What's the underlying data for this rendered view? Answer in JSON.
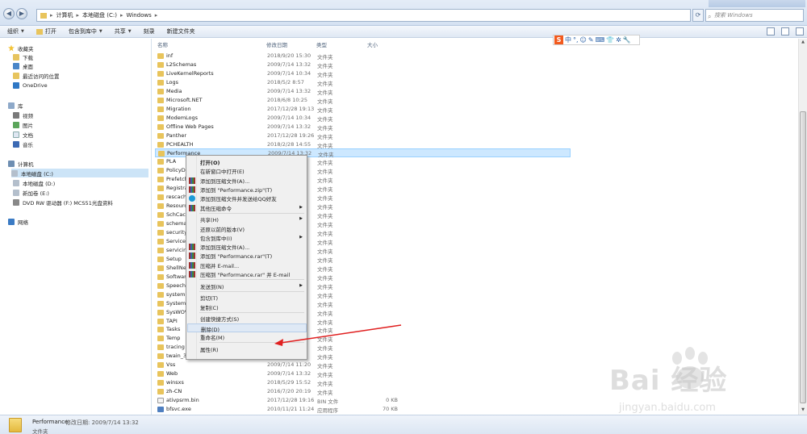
{
  "addressbar": {
    "crumbs": [
      "计算机",
      "本地磁盘 (C:)",
      "Windows"
    ],
    "search_placeholder": "搜索 Windows"
  },
  "toolbar": {
    "organize": "组织",
    "open": "打开",
    "include_library": "包含到库中",
    "share": "共享",
    "burn": "刻录",
    "new_folder": "新建文件夹"
  },
  "ime": {
    "logo": "S",
    "glyphs": [
      "中",
      "°,",
      "☺",
      "✎",
      "⌨",
      "👕",
      "✲",
      "🔧"
    ]
  },
  "navpane": {
    "favorites": "收藏夹",
    "downloads": "下载",
    "desktop": "桌面",
    "recent": "最近访问的位置",
    "onedrive": "OneDrive",
    "libraries": "库",
    "videos": "视频",
    "pictures": "图片",
    "documents": "文档",
    "music": "音乐",
    "computer": "计算机",
    "drive_c": "本地磁盘 (C:)",
    "drive_d": "本地磁盘 (D:)",
    "drive_e": "新加卷 (E:)",
    "drive_f": "DVD RW 驱动器 (F:) MCS51光盘资料",
    "network": "网络"
  },
  "columns": {
    "name": "名称",
    "date": "修改日期",
    "type": "类型",
    "size": "大小"
  },
  "files": [
    {
      "name": "inf",
      "date": "2018/9/20 15:30",
      "type": "文件夹",
      "size": ""
    },
    {
      "name": "L2Schemas",
      "date": "2009/7/14 13:32",
      "type": "文件夹",
      "size": ""
    },
    {
      "name": "LiveKernelReports",
      "date": "2009/7/14 10:34",
      "type": "文件夹",
      "size": ""
    },
    {
      "name": "Logs",
      "date": "2018/5/2 8:57",
      "type": "文件夹",
      "size": ""
    },
    {
      "name": "Media",
      "date": "2009/7/14 13:32",
      "type": "文件夹",
      "size": ""
    },
    {
      "name": "Microsoft.NET",
      "date": "2018/6/8 10:25",
      "type": "文件夹",
      "size": ""
    },
    {
      "name": "Migration",
      "date": "2017/12/28 19:13",
      "type": "文件夹",
      "size": ""
    },
    {
      "name": "ModemLogs",
      "date": "2009/7/14 10:34",
      "type": "文件夹",
      "size": ""
    },
    {
      "name": "Offline Web Pages",
      "date": "2009/7/14 13:32",
      "type": "文件夹",
      "size": ""
    },
    {
      "name": "Panther",
      "date": "2017/12/28 19:26",
      "type": "文件夹",
      "size": ""
    },
    {
      "name": "PCHEALTH",
      "date": "2018/2/28 14:55",
      "type": "文件夹",
      "size": ""
    },
    {
      "name": "Performance",
      "date": "2009/7/14 13:32",
      "type": "文件夹",
      "size": ""
    },
    {
      "name": "PLA",
      "date": "",
      "type": "文件夹",
      "size": ""
    },
    {
      "name": "PolicyDe",
      "date": "",
      "type": "文件夹",
      "size": ""
    },
    {
      "name": "Prefetch",
      "date": "",
      "type": "文件夹",
      "size": ""
    },
    {
      "name": "Registra",
      "date": "",
      "type": "文件夹",
      "size": ""
    },
    {
      "name": "rescach",
      "date": "",
      "type": "文件夹",
      "size": ""
    },
    {
      "name": "Resourc",
      "date": "",
      "type": "文件夹",
      "size": ""
    },
    {
      "name": "SchCach",
      "date": "",
      "type": "文件夹",
      "size": ""
    },
    {
      "name": "schemas",
      "date": "",
      "type": "文件夹",
      "size": ""
    },
    {
      "name": "security",
      "date": "",
      "type": "文件夹",
      "size": ""
    },
    {
      "name": "ServiceP",
      "date": "",
      "type": "文件夹",
      "size": ""
    },
    {
      "name": "servicing",
      "date": "",
      "type": "文件夹",
      "size": ""
    },
    {
      "name": "Setup",
      "date": "",
      "type": "文件夹",
      "size": ""
    },
    {
      "name": "ShellNe",
      "date": "",
      "type": "文件夹",
      "size": ""
    },
    {
      "name": "Softwar",
      "date": "",
      "type": "文件夹",
      "size": ""
    },
    {
      "name": "Speech",
      "date": "",
      "type": "文件夹",
      "size": ""
    },
    {
      "name": "system",
      "date": "",
      "type": "文件夹",
      "size": ""
    },
    {
      "name": "System3",
      "date": "",
      "type": "文件夹",
      "size": ""
    },
    {
      "name": "SysWOV",
      "date": "",
      "type": "文件夹",
      "size": ""
    },
    {
      "name": "TAPI",
      "date": "",
      "type": "文件夹",
      "size": ""
    },
    {
      "name": "Tasks",
      "date": "",
      "type": "文件夹",
      "size": ""
    },
    {
      "name": "Temp",
      "date": "",
      "type": "文件夹",
      "size": ""
    },
    {
      "name": "tracing",
      "date": "",
      "type": "文件夹",
      "size": ""
    },
    {
      "name": "twain_32",
      "date": "",
      "type": "文件夹",
      "size": ""
    },
    {
      "name": "Vss",
      "date": "2009/7/14 11:20",
      "type": "文件夹",
      "size": ""
    },
    {
      "name": "Web",
      "date": "2009/7/14 13:32",
      "type": "文件夹",
      "size": ""
    },
    {
      "name": "winsxs",
      "date": "2018/5/29 15:52",
      "type": "文件夹",
      "size": ""
    },
    {
      "name": "zh-CN",
      "date": "2016/7/20 20:19",
      "type": "文件夹",
      "size": ""
    },
    {
      "name": "ativpsrm.bin",
      "date": "2017/12/28 19:16",
      "type": "BIN 文件",
      "size": "0 KB"
    },
    {
      "name": "bfsvc.exe",
      "date": "2010/11/21 11:24",
      "type": "应用程序",
      "size": "70 KB"
    }
  ],
  "menu": [
    {
      "label": "打开(O)",
      "bold": true,
      "arrow": false,
      "icon": ""
    },
    {
      "label": "在新窗口中打开(E)",
      "arrow": false,
      "icon": ""
    },
    {
      "label": "添加到压缩文件(A)...",
      "arrow": false,
      "icon": "rar"
    },
    {
      "label": "添加到 \"Performance.zip\"(T)",
      "arrow": false,
      "icon": "rar"
    },
    {
      "label": "添加到压缩文件并发送给QQ好友",
      "arrow": false,
      "icon": "qq"
    },
    {
      "label": "其他压缩命令",
      "arrow": true,
      "icon": "rar"
    },
    {
      "sep": true
    },
    {
      "label": "共享(H)",
      "arrow": true,
      "icon": ""
    },
    {
      "label": "还原以前的版本(V)",
      "arrow": false,
      "icon": ""
    },
    {
      "label": "包含到库中(I)",
      "arrow": true,
      "icon": ""
    },
    {
      "label": "添加到压缩文件(A)...",
      "arrow": false,
      "icon": "rar"
    },
    {
      "label": "添加到 \"Performance.rar\"(T)",
      "arrow": false,
      "icon": "rar"
    },
    {
      "label": "压缩并 E-mail...",
      "arrow": false,
      "icon": "rar"
    },
    {
      "label": "压缩到 \"Performance.rar\" 并 E-mail",
      "arrow": false,
      "icon": "rar"
    },
    {
      "sep": true
    },
    {
      "label": "发送到(N)",
      "arrow": true,
      "icon": ""
    },
    {
      "sep": true
    },
    {
      "label": "剪切(T)",
      "arrow": false,
      "icon": ""
    },
    {
      "label": "复制(C)",
      "arrow": false,
      "icon": ""
    },
    {
      "sep": true
    },
    {
      "label": "创建快捷方式(S)",
      "arrow": false,
      "icon": ""
    },
    {
      "label": "删除(D)",
      "arrow": false,
      "icon": "",
      "highlight": true
    },
    {
      "label": "重命名(M)",
      "arrow": false,
      "icon": ""
    },
    {
      "sep": true
    },
    {
      "label": "属性(R)",
      "arrow": false,
      "icon": ""
    }
  ],
  "statusbar": {
    "name": "Performance",
    "meta": "修改日期: 2009/7/14 13:32",
    "type": "文件夹"
  },
  "watermark": {
    "logo": "Bai  经验",
    "url": "jingyan.baidu.com"
  },
  "colors": {
    "arrow": "#e02020",
    "selection": "#cde8ff"
  }
}
